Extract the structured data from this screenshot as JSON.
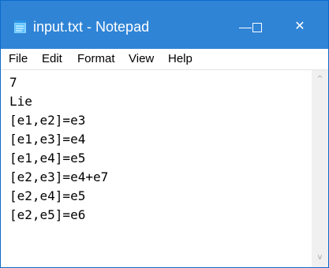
{
  "window": {
    "title": "input.txt - Notepad",
    "titlebar_color": "#2f84d6",
    "icon": "notepad-icon",
    "controls": {
      "minimize": "minimize-icon",
      "maximize": "maximize-icon",
      "close": "close-icon",
      "close_glyph": "✕"
    }
  },
  "menubar": {
    "items": [
      "File",
      "Edit",
      "Format",
      "View",
      "Help"
    ]
  },
  "editor": {
    "lines": [
      "7",
      "Lie",
      "[e1,e2]=e3",
      "[e1,e3]=e4",
      "[e1,e4]=e5",
      "[e2,e3]=e4+e7",
      "[e2,e4]=e5",
      "[e2,e5]=e6"
    ]
  },
  "scrollbar": {
    "up_glyph": "^",
    "down_glyph": "v"
  }
}
